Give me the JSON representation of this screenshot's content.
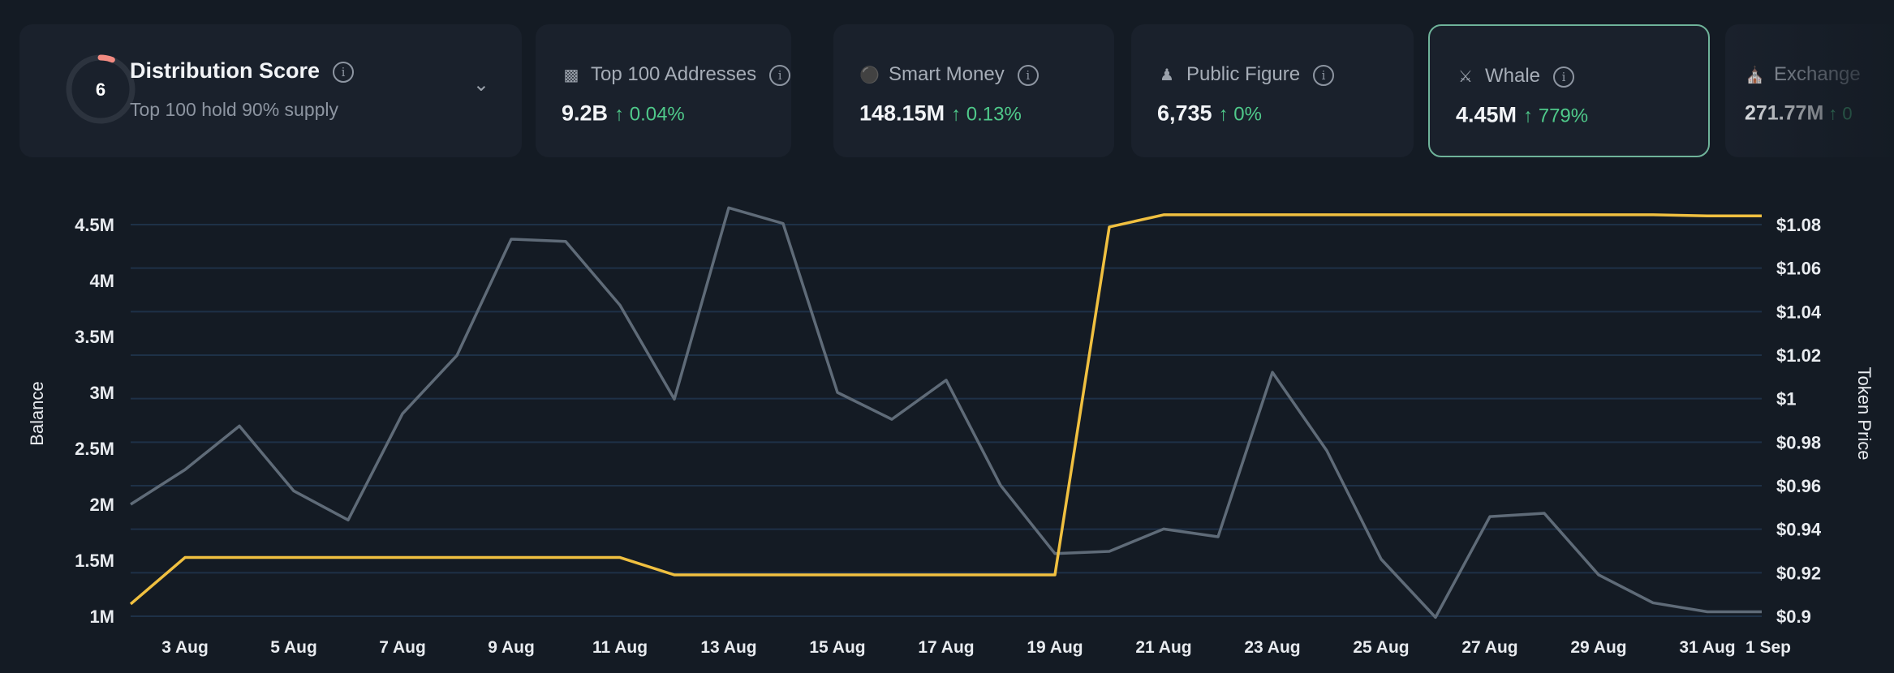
{
  "distribution": {
    "title": "Distribution Score",
    "score": "6",
    "score_value": 6,
    "score_max": 100,
    "subtitle": "Top 100 hold 90% supply",
    "ring_color": "#f28b82"
  },
  "metrics": [
    {
      "icon": "money-icon",
      "title": "Top 100 Addresses",
      "value": "9.2B",
      "change": "↑ 0.04%"
    },
    {
      "icon": "sunglasses-icon",
      "title": "Smart Money",
      "value": "148.15M",
      "change": "↑ 0.13%"
    },
    {
      "icon": "public-figure-icon",
      "title": "Public Figure",
      "value": "6,735",
      "change": "↑ 0%"
    },
    {
      "icon": "whale-icon",
      "title": "Whale",
      "value": "4.45M",
      "change": "↑ 779%",
      "selected": true
    },
    {
      "icon": "bank-icon",
      "title": "Exchange",
      "value": "271.77M",
      "change": "↑ 0"
    }
  ],
  "colors": {
    "balance": "#5f6b78",
    "price": "#f0c040",
    "grid": "#1e3147",
    "positive": "#4fc98a"
  },
  "chart_data": {
    "type": "line",
    "ylabel": "Balance",
    "y2label": "Token Price",
    "x": [
      "2 Aug",
      "3 Aug",
      "4 Aug",
      "5 Aug",
      "6 Aug",
      "7 Aug",
      "8 Aug",
      "9 Aug",
      "10 Aug",
      "11 Aug",
      "12 Aug",
      "13 Aug",
      "14 Aug",
      "15 Aug",
      "16 Aug",
      "17 Aug",
      "18 Aug",
      "19 Aug",
      "20 Aug",
      "21 Aug",
      "22 Aug",
      "23 Aug",
      "24 Aug",
      "25 Aug",
      "26 Aug",
      "27 Aug",
      "28 Aug",
      "29 Aug",
      "30 Aug",
      "31 Aug",
      "1 Sep"
    ],
    "x_tick_labels": [
      "3 Aug",
      "5 Aug",
      "7 Aug",
      "9 Aug",
      "11 Aug",
      "13 Aug",
      "15 Aug",
      "17 Aug",
      "19 Aug",
      "21 Aug",
      "23 Aug",
      "25 Aug",
      "27 Aug",
      "29 Aug",
      "31 Aug",
      "1 Sep"
    ],
    "y_tick_labels": [
      "1M",
      "1.5M",
      "2M",
      "2.5M",
      "3M",
      "3.5M",
      "4M",
      "4.5M"
    ],
    "y2_tick_labels": [
      "$0.9",
      "$0.92",
      "$0.94",
      "$0.96",
      "$0.98",
      "$1",
      "$1.02",
      "$1.04",
      "$1.06",
      "$1.08"
    ],
    "ylim": [
      1000000,
      4500000
    ],
    "y2lim": [
      0.9,
      1.08
    ],
    "grid": true,
    "series": [
      {
        "axis": "left",
        "values": [
          2000000,
          2310000,
          2700000,
          2120000,
          1860000,
          2810000,
          3330000,
          4370000,
          4350000,
          3780000,
          2940000,
          4650000,
          4510000,
          3000000,
          2760000,
          3110000,
          2170000,
          1560000,
          1580000,
          1780000,
          1710000,
          3180000,
          2480000,
          1510000,
          990000,
          1890000,
          1920000,
          1370000,
          1120000,
          1040000,
          1040000
        ]
      },
      {
        "axis": "right",
        "values": [
          0.9056,
          0.927,
          0.927,
          0.927,
          0.927,
          0.927,
          0.927,
          0.927,
          0.927,
          0.927,
          0.919,
          0.919,
          0.919,
          0.919,
          0.919,
          0.919,
          0.919,
          0.919,
          1.0789,
          1.0845,
          1.0845,
          1.0845,
          1.0845,
          1.0845,
          1.0845,
          1.0845,
          1.0845,
          1.0845,
          1.0845,
          1.084,
          1.084
        ]
      }
    ]
  }
}
